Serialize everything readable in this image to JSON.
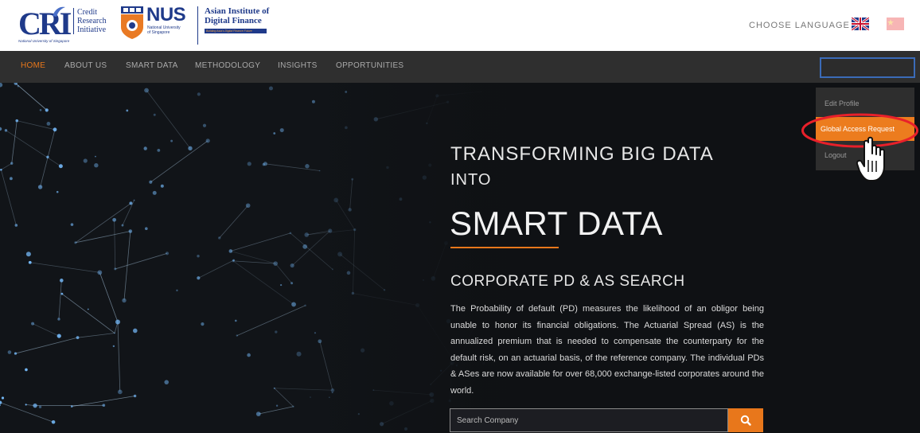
{
  "header": {
    "cri_logo": {
      "letters": "CRI",
      "line1": "Credit",
      "line2": "Research",
      "line3": "Initiative",
      "sub": "National University of Singapore"
    },
    "nus_logo": {
      "word": "NUS",
      "line1": "National University",
      "line2": "of Singapore"
    },
    "aidf_logo": {
      "line1": "Asian Institute of",
      "line2": "Digital Finance",
      "tagline": "Building Asia's Digital Finance Future"
    },
    "choose_language": "CHOOSE LANGUAGE"
  },
  "nav": {
    "items": [
      {
        "label": "HOME",
        "active": true
      },
      {
        "label": "ABOUT US",
        "active": false
      },
      {
        "label": "SMART DATA",
        "active": false
      },
      {
        "label": "METHODOLOGY",
        "active": false
      },
      {
        "label": "INSIGHTS",
        "active": false
      },
      {
        "label": "OPPORTUNITIES",
        "active": false
      }
    ]
  },
  "user_menu": {
    "items": [
      "Edit Profile",
      "Global Access Request",
      "Logout"
    ],
    "highlighted": "Global Access Request"
  },
  "hero": {
    "line1": "TRANSFORMING BIG DATA",
    "line2": "INTO",
    "big": "SMART DATA",
    "subtitle": "CORPORATE PD & AS SEARCH",
    "paragraph": "The Probability of default (PD) measures the likelihood of an obligor being unable to honor its financial obligations. The Actuarial Spread (AS) is the annualized premium that is needed to compensate the counterparty for the default risk, on an actuarial basis, of the reference company. The individual PDs & ASes are now available for over 68,000 exchange-listed corporates around the world.",
    "search": {
      "placeholder": "Search Company",
      "value": ""
    }
  },
  "icons": {
    "search_button": "search-icon",
    "flag_english": "uk-flag-icon",
    "flag_chinese": "china-flag-icon",
    "cursor": "hand-pointer-icon"
  },
  "colors": {
    "accent": "#e8771b",
    "nav_bg": "#2f2f2f",
    "brand_blue": "#1f3a8a",
    "annotation": "#e8202a"
  }
}
